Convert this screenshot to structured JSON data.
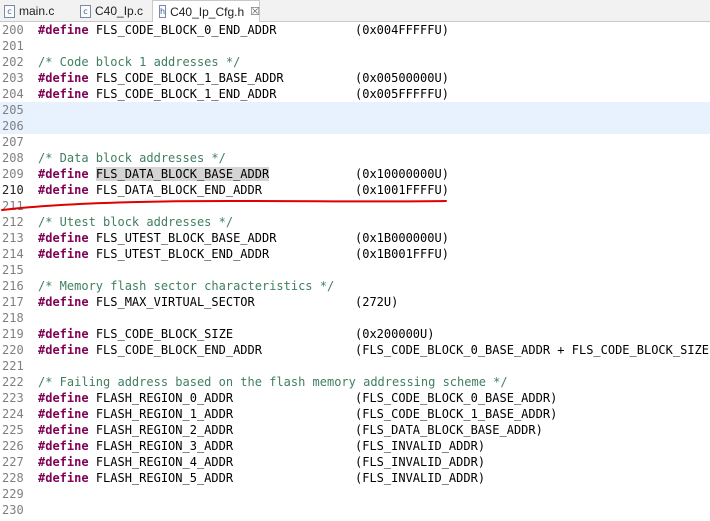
{
  "tabs": [
    {
      "label": "main.c",
      "active": false,
      "icon": "c-file-icon"
    },
    {
      "label": "C40_Ip.c",
      "active": false,
      "icon": "c-file-icon"
    },
    {
      "label": "C40_Ip_Cfg.h",
      "active": true,
      "icon": "h-file-icon",
      "close": "☒"
    }
  ],
  "lines": [
    {
      "n": "200",
      "kind": "define",
      "kw": "#define",
      "name": "FLS_CODE_BLOCK_0_END_ADDR",
      "value": "(0x004FFFFFU)"
    },
    {
      "n": "201",
      "kind": "blank"
    },
    {
      "n": "202",
      "kind": "comment",
      "text": "/* Code block 1 addresses */"
    },
    {
      "n": "203",
      "kind": "define",
      "kw": "#define",
      "name": "FLS_CODE_BLOCK_1_BASE_ADDR",
      "value": "(0x00500000U)"
    },
    {
      "n": "204",
      "kind": "define",
      "kw": "#define",
      "name": "FLS_CODE_BLOCK_1_END_ADDR",
      "value": "(0x005FFFFFU)"
    },
    {
      "n": "205",
      "kind": "blank",
      "highlight": true
    },
    {
      "n": "206",
      "kind": "blank",
      "highlight": true
    },
    {
      "n": "207",
      "kind": "blank"
    },
    {
      "n": "208",
      "kind": "comment",
      "text": "/* Data block addresses */"
    },
    {
      "n": "209",
      "kind": "define",
      "kw": "#define",
      "name": "FLS_DATA_BLOCK_BASE_ADDR",
      "value": "(0x10000000U)",
      "selected": true
    },
    {
      "n": "210",
      "kind": "define",
      "kw": "#define",
      "name": "FLS_DATA_BLOCK_END_ADDR",
      "value": "(0x1001FFFFU)",
      "current": true
    },
    {
      "n": "211",
      "kind": "blank"
    },
    {
      "n": "212",
      "kind": "comment",
      "text": "/* Utest block addresses */"
    },
    {
      "n": "213",
      "kind": "define",
      "kw": "#define",
      "name": "FLS_UTEST_BLOCK_BASE_ADDR",
      "value": "(0x1B000000U)"
    },
    {
      "n": "214",
      "kind": "define",
      "kw": "#define",
      "name": "FLS_UTEST_BLOCK_END_ADDR",
      "value": "(0x1B001FFFU)"
    },
    {
      "n": "215",
      "kind": "blank"
    },
    {
      "n": "216",
      "kind": "comment",
      "text": "/* Memory flash sector characteristics */"
    },
    {
      "n": "217",
      "kind": "define",
      "kw": "#define",
      "name": "FLS_MAX_VIRTUAL_SECTOR",
      "value": "(272U)"
    },
    {
      "n": "218",
      "kind": "blank"
    },
    {
      "n": "219",
      "kind": "define",
      "kw": "#define",
      "name": "FLS_CODE_BLOCK_SIZE",
      "value": "(0x200000U)"
    },
    {
      "n": "220",
      "kind": "define",
      "kw": "#define",
      "name": "FLS_CODE_BLOCK_END_ADDR",
      "value": "(FLS_CODE_BLOCK_0_BASE_ADDR + FLS_CODE_BLOCK_SIZE"
    },
    {
      "n": "221",
      "kind": "blank"
    },
    {
      "n": "222",
      "kind": "comment",
      "text": "/* Failing address based on the flash memory addressing scheme */"
    },
    {
      "n": "223",
      "kind": "define",
      "kw": "#define",
      "name": "FLASH_REGION_0_ADDR",
      "value": "(FLS_CODE_BLOCK_0_BASE_ADDR)"
    },
    {
      "n": "224",
      "kind": "define",
      "kw": "#define",
      "name": "FLASH_REGION_1_ADDR",
      "value": "(FLS_CODE_BLOCK_1_BASE_ADDR)"
    },
    {
      "n": "225",
      "kind": "define",
      "kw": "#define",
      "name": "FLASH_REGION_2_ADDR",
      "value": "(FLS_DATA_BLOCK_BASE_ADDR)"
    },
    {
      "n": "226",
      "kind": "define",
      "kw": "#define",
      "name": "FLASH_REGION_3_ADDR",
      "value": "(FLS_INVALID_ADDR)"
    },
    {
      "n": "227",
      "kind": "define",
      "kw": "#define",
      "name": "FLASH_REGION_4_ADDR",
      "value": "(FLS_INVALID_ADDR)"
    },
    {
      "n": "228",
      "kind": "define",
      "kw": "#define",
      "name": "FLASH_REGION_5_ADDR",
      "value": "(FLS_INVALID_ADDR)"
    },
    {
      "n": "229",
      "kind": "blank"
    },
    {
      "n": "230",
      "kind": "blank"
    }
  ],
  "colors": {
    "keyword": "#7f0055",
    "comment": "#3f7f5f",
    "line_number": "#808080",
    "current_line_bg": "#e8f2fe",
    "annotation_red": "#e00000"
  }
}
